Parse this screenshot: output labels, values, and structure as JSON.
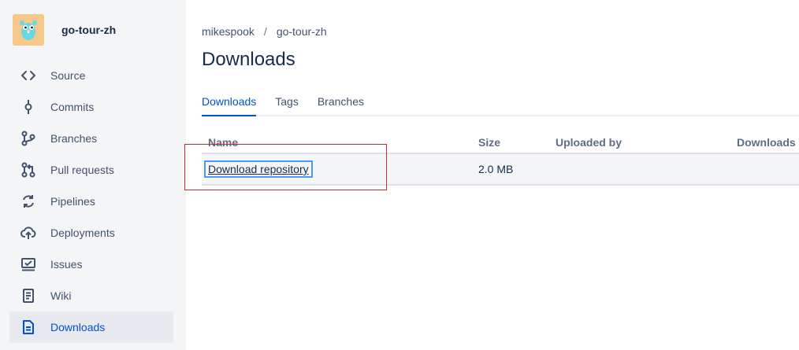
{
  "repo": {
    "name": "go-tour-zh"
  },
  "sidebar": {
    "items": [
      {
        "label": "Source",
        "icon": "code-icon"
      },
      {
        "label": "Commits",
        "icon": "commit-icon"
      },
      {
        "label": "Branches",
        "icon": "branch-icon"
      },
      {
        "label": "Pull requests",
        "icon": "pull-request-icon"
      },
      {
        "label": "Pipelines",
        "icon": "pipelines-icon"
      },
      {
        "label": "Deployments",
        "icon": "cloud-upload-icon"
      },
      {
        "label": "Issues",
        "icon": "issues-icon"
      },
      {
        "label": "Wiki",
        "icon": "wiki-icon"
      },
      {
        "label": "Downloads",
        "icon": "download-file-icon",
        "active": true
      }
    ]
  },
  "breadcrumb": {
    "owner": "mikespook",
    "separator": "/",
    "repo": "go-tour-zh"
  },
  "page": {
    "title": "Downloads"
  },
  "tabs": [
    {
      "label": "Downloads",
      "active": true
    },
    {
      "label": "Tags"
    },
    {
      "label": "Branches"
    }
  ],
  "table": {
    "headers": {
      "name": "Name",
      "size": "Size",
      "uploaded_by": "Uploaded by",
      "downloads": "Downloads"
    },
    "rows": [
      {
        "name": "Download repository",
        "size": "2.0 MB",
        "uploaded_by": "",
        "downloads": ""
      }
    ]
  },
  "colors": {
    "accent": "#0052cc",
    "sidebar_bg": "#f4f5f7",
    "highlight": "#cc2b2b"
  }
}
